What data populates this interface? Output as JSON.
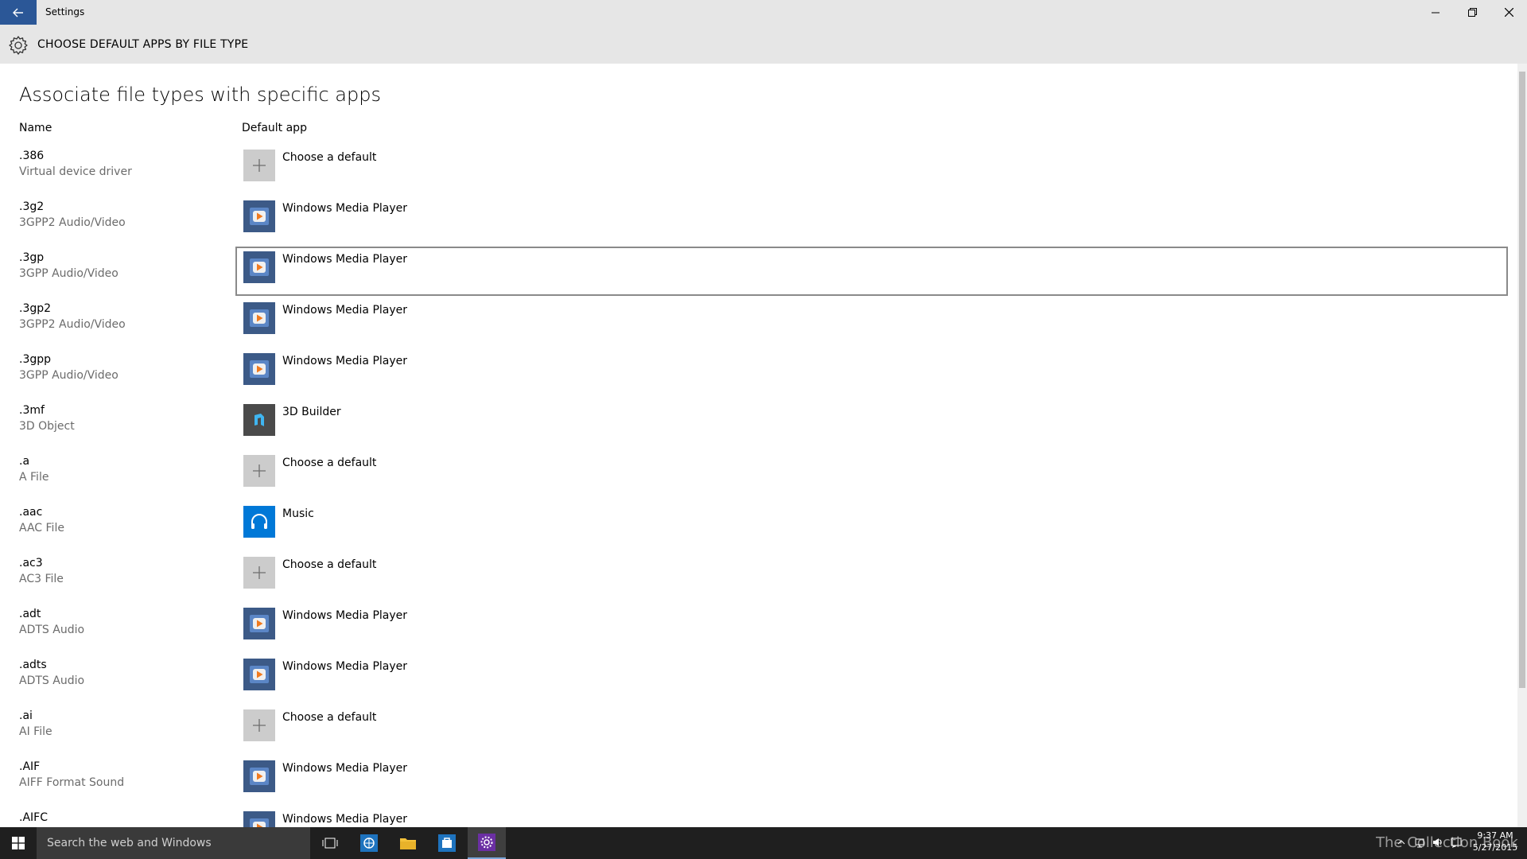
{
  "window": {
    "title": "Settings"
  },
  "header": {
    "title": "CHOOSE DEFAULT APPS BY FILE TYPE"
  },
  "main": {
    "heading": "Associate file types with specific apps",
    "columns": {
      "name": "Name",
      "default_app": "Default app"
    },
    "rows": [
      {
        "ext": ".386",
        "desc": "Virtual device driver",
        "app": "Choose a default",
        "icon": "add-icon"
      },
      {
        "ext": ".3g2",
        "desc": "3GPP2 Audio/Video",
        "app": "Windows Media Player",
        "icon": "windows-media-player-icon"
      },
      {
        "ext": ".3gp",
        "desc": "3GPP Audio/Video",
        "app": "Windows Media Player",
        "icon": "windows-media-player-icon",
        "focused": true
      },
      {
        "ext": ".3gp2",
        "desc": "3GPP2 Audio/Video",
        "app": "Windows Media Player",
        "icon": "windows-media-player-icon"
      },
      {
        "ext": ".3gpp",
        "desc": "3GPP Audio/Video",
        "app": "Windows Media Player",
        "icon": "windows-media-player-icon"
      },
      {
        "ext": ".3mf",
        "desc": "3D Object",
        "app": "3D Builder",
        "icon": "3d-builder-icon"
      },
      {
        "ext": ".a",
        "desc": "A File",
        "app": "Choose a default",
        "icon": "add-icon"
      },
      {
        "ext": ".aac",
        "desc": "AAC File",
        "app": "Music",
        "icon": "music-icon"
      },
      {
        "ext": ".ac3",
        "desc": "AC3 File",
        "app": "Choose a default",
        "icon": "add-icon"
      },
      {
        "ext": ".adt",
        "desc": "ADTS Audio",
        "app": "Windows Media Player",
        "icon": "windows-media-player-icon"
      },
      {
        "ext": ".adts",
        "desc": "ADTS Audio",
        "app": "Windows Media Player",
        "icon": "windows-media-player-icon"
      },
      {
        "ext": ".ai",
        "desc": "AI File",
        "app": "Choose a default",
        "icon": "add-icon"
      },
      {
        "ext": ".AIF",
        "desc": "AIFF Format Sound",
        "app": "Windows Media Player",
        "icon": "windows-media-player-icon"
      },
      {
        "ext": ".AIFC",
        "desc": "",
        "app": "Windows Media Player",
        "icon": "windows-media-player-icon"
      }
    ]
  },
  "taskbar": {
    "search_placeholder": "Search the web and Windows",
    "watermark": "The Collection Book",
    "time": "9:37 AM",
    "date": "5/27/2015"
  },
  "colors": {
    "accent": "#2b5797",
    "header_bg": "#e6e6e6",
    "taskbar_bg": "#1f1f1f",
    "wmp_tile": "#3c5a87",
    "music_tile": "#0078d7"
  }
}
